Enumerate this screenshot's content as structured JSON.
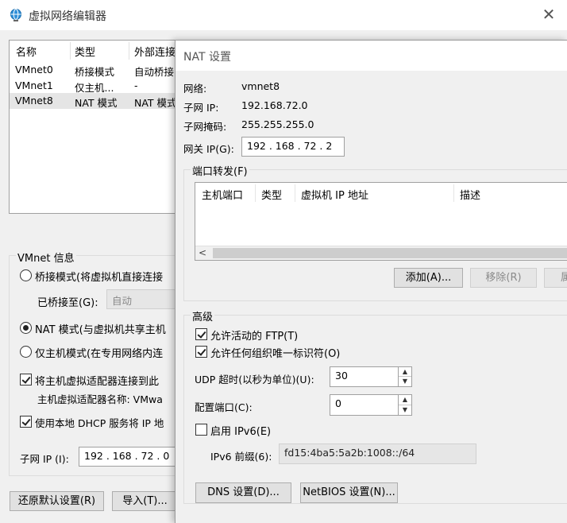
{
  "window": {
    "title": "虚拟网络编辑器",
    "close_glyph": "✕"
  },
  "network_list": {
    "headers": [
      "名称",
      "类型",
      "外部连接"
    ],
    "rows": [
      {
        "name": "VMnet0",
        "type": "桥接模式",
        "external": "自动桥接"
      },
      {
        "name": "VMnet1",
        "type": "仅主机...",
        "external": "-"
      },
      {
        "name": "VMnet8",
        "type": "NAT 模式",
        "external": "NAT 模式",
        "selected": true
      }
    ]
  },
  "vmnet_info": {
    "title": "VMnet 信息",
    "bridged_label": "桥接模式(将虚拟机直接连接",
    "bridged_to_label": "已桥接至(G):",
    "bridged_to_value": "自动",
    "nat_label": "NAT 模式(与虚拟机共享主机",
    "hostonly_label": "仅主机模式(在专用网络内连",
    "connect_adapter_label": "将主机虚拟适配器连接到此",
    "adapter_name_label": "主机虚拟适配器名称: VMwa",
    "dhcp_label": "使用本地 DHCP 服务将 IP 地",
    "subnet_ip_label": "子网 IP (I):",
    "subnet_ip_value": "192 . 168 . 72 . 0"
  },
  "bottom_buttons": {
    "restore_label": "还原默认设置(R)",
    "import_label": "导入(T)..."
  },
  "nat": {
    "title": "NAT 设置",
    "network_label": "网络:",
    "network_value": "vmnet8",
    "subnet_ip_label": "子网 IP:",
    "subnet_ip_value": "192.168.72.0",
    "subnet_mask_label": "子网掩码:",
    "subnet_mask_value": "255.255.255.0",
    "gateway_label": "网关 IP(G):",
    "gateway_value": "192 . 168 . 72 . 2",
    "port_forward_title": "端口转发(F)",
    "pf_headers": [
      "主机端口",
      "类型",
      "虚拟机 IP 地址",
      "描述"
    ],
    "scroll_left_glyph": "<",
    "add_label": "添加(A)...",
    "remove_label": "移除(R)",
    "properties_label": "属",
    "advanced_title": "高级",
    "ftp_label": "允许活动的 FTP(T)",
    "oui_label": "允许任何组织唯一标识符(O)",
    "udp_label": "UDP 超时(以秒为单位)(U):",
    "udp_value": "30",
    "config_port_label": "配置端口(C):",
    "config_port_value": "0",
    "ipv6_label": "启用 IPv6(E)",
    "ipv6_prefix_label": "IPv6 前缀(6):",
    "ipv6_prefix_value": "fd15:4ba5:5a2b:1008::/64",
    "dns_label": "DNS 设置(D)...",
    "netbios_label": "NetBIOS 设置(N)..."
  }
}
